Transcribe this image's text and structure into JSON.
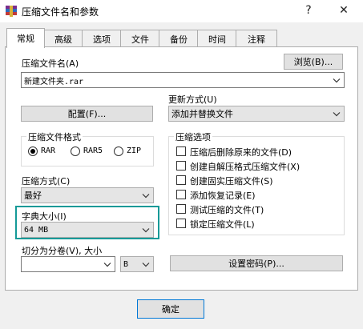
{
  "window": {
    "title": "压缩文件名和参数",
    "help_label": "?",
    "close_label": "✕"
  },
  "tabs": [
    "常规",
    "高级",
    "选项",
    "文件",
    "备份",
    "时间",
    "注释"
  ],
  "general": {
    "archive_name_label": "压缩文件名(A)",
    "browse_label": "浏览(B)...",
    "archive_name_value": "新建文件夹.rar",
    "profile_label": "配置(F)...",
    "update_mode_label": "更新方式(U)",
    "update_mode_value": "添加并替换文件",
    "format_group_title": "压缩文件格式",
    "formats": [
      {
        "label": "RAR",
        "checked": true
      },
      {
        "label": "RAR5",
        "checked": false
      },
      {
        "label": "ZIP",
        "checked": false
      }
    ],
    "options_group_title": "压缩选项",
    "options": [
      {
        "label": "压缩后删除原来的文件(D)",
        "checked": false
      },
      {
        "label": "创建自解压格式压缩文件(X)",
        "checked": false
      },
      {
        "label": "创建固实压缩文件(S)",
        "checked": false
      },
      {
        "label": "添加恢复记录(E)",
        "checked": false
      },
      {
        "label": "测试压缩的文件(T)",
        "checked": false
      },
      {
        "label": "锁定压缩文件(L)",
        "checked": false
      }
    ],
    "method_label": "压缩方式(C)",
    "method_value": "最好",
    "dict_label": "字典大小(I)",
    "dict_value": "64 MB",
    "split_label": "切分为分卷(V), 大小",
    "split_value": "",
    "split_unit": "B",
    "password_label": "设置密码(P)..."
  },
  "footer": {
    "ok_label": "确定"
  },
  "accent_color": "#159a98"
}
